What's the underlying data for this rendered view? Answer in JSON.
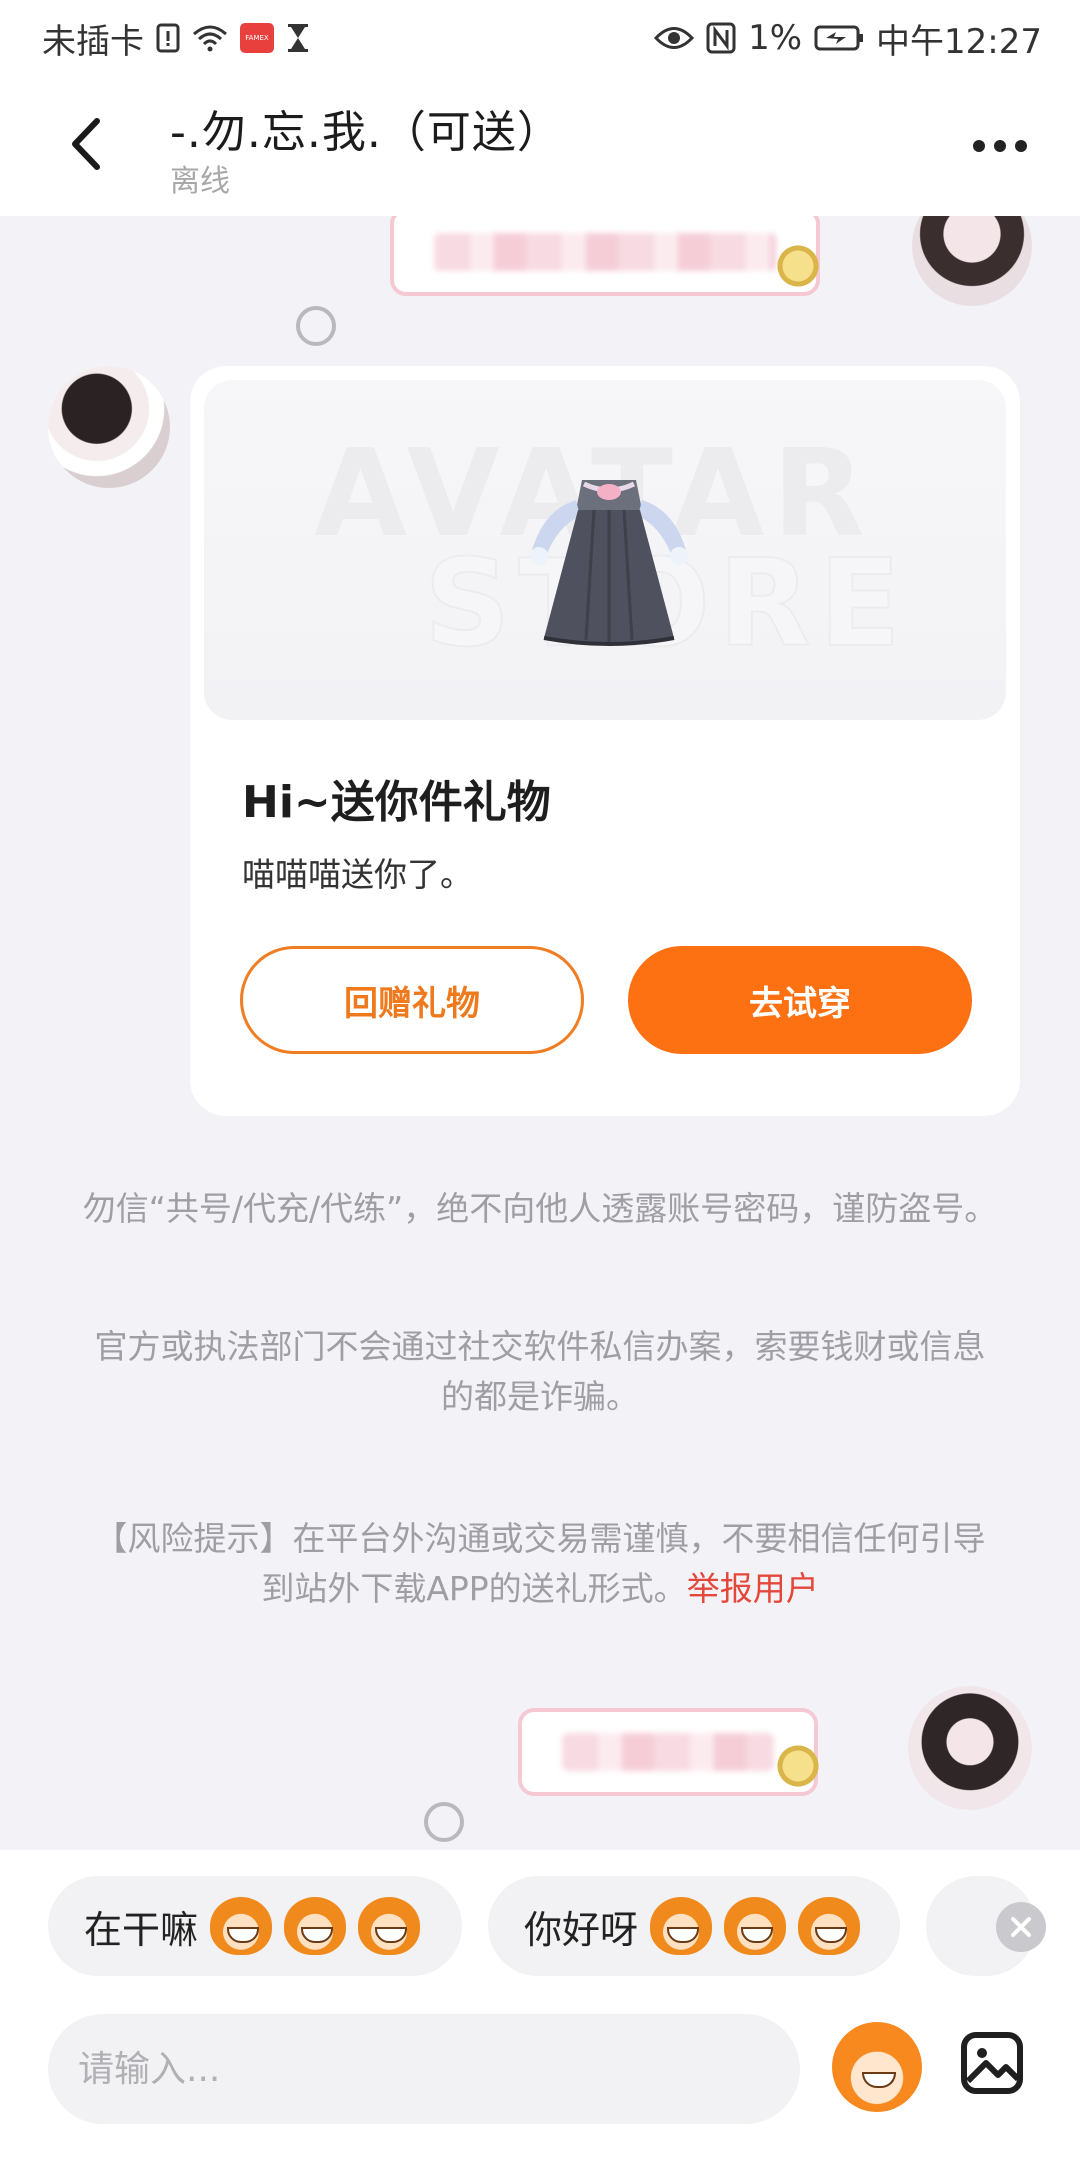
{
  "status_bar": {
    "left_text": "未插卡",
    "app_badge": "FAMEX",
    "battery": "1%",
    "time": "中午12:27",
    "icons": [
      "sim-alert-icon",
      "wifi-icon",
      "app-notification-icon",
      "hourglass-icon",
      "eye-icon",
      "nfc-icon",
      "battery-charging-icon"
    ]
  },
  "header": {
    "title": "-.勿.忘.我.（可送）",
    "subtitle": "离线",
    "back_icon": "chevron-left-icon",
    "more_icon": "more-dots-icon"
  },
  "gift_card": {
    "watermark_line1": "AVATAR",
    "watermark_line2": "STORE",
    "title": "Hi~送你件礼物",
    "message": "喵喵喵送你了。",
    "return_gift_label": "回赠礼物",
    "try_on_label": "去试穿",
    "accent_color": "#fd7113"
  },
  "notices": {
    "line1": "勿信“共号/代充/代练”，绝不向他人透露账号密码，谨防盗号。",
    "line2": "官方或执法部门不会通过社交软件私信办案，索要钱财或信息的都是诈骗。",
    "line3_text": "【风险提示】在平台外沟通或交易需谨慎，不要相信任何引导到站外下载APP的送礼形式。",
    "line3_link": "举报用户",
    "link_color": "#e5473b"
  },
  "quick_replies": [
    {
      "label": "在干嘛",
      "emoji": "grinning-monkey-emoji"
    },
    {
      "label": "你好呀",
      "emoji": "surprised-monkey-emoji"
    }
  ],
  "input": {
    "placeholder": "请输入..."
  }
}
